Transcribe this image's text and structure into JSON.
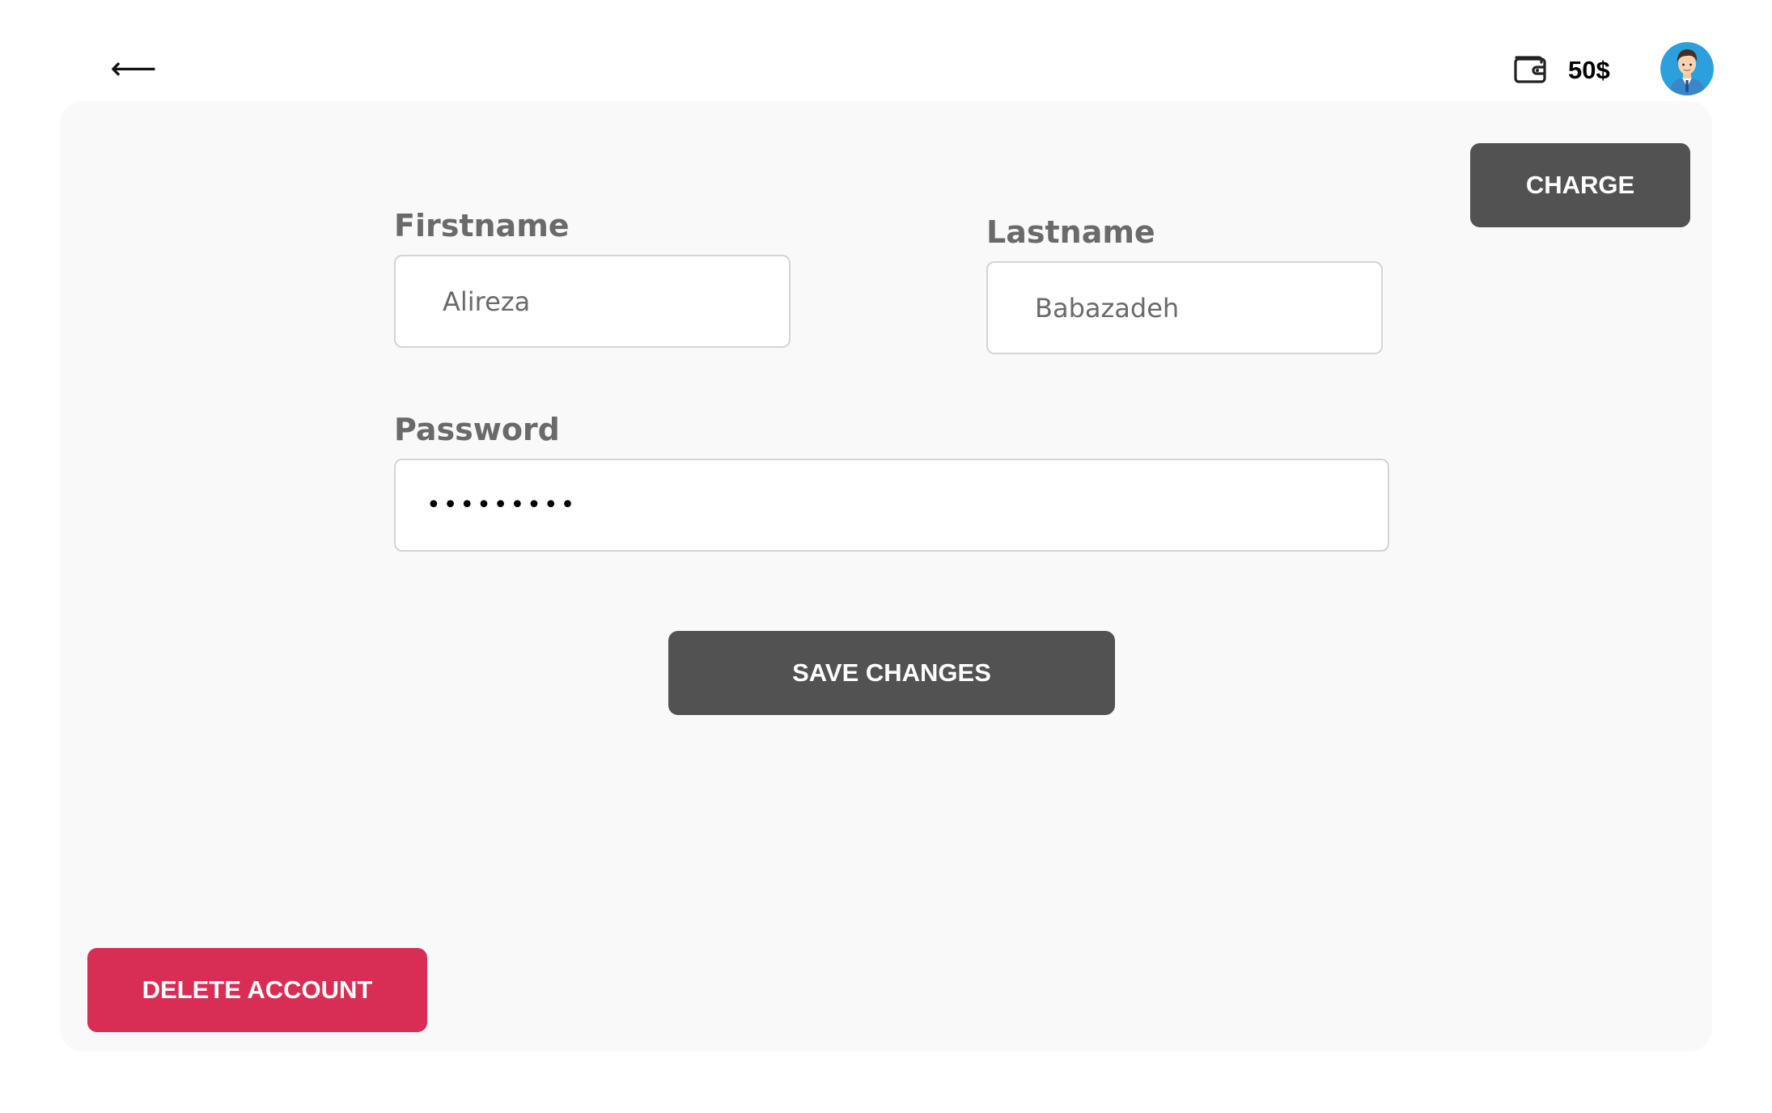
{
  "header": {
    "back_icon": "left-arrow-icon",
    "back_glyph": "⟵",
    "wallet_icon": "wallet-icon",
    "balance": "50$",
    "avatar_icon": "user-avatar"
  },
  "form": {
    "firstname": {
      "label": "Firstname",
      "value": "Alireza"
    },
    "lastname": {
      "label": "Lastname",
      "value": "Babazadeh"
    },
    "password": {
      "label": "Password",
      "value": "•••••••••"
    }
  },
  "buttons": {
    "charge": "CHARGE",
    "save": "SAVE CHANGES",
    "delete": "DELETE ACCOUNT"
  },
  "colors": {
    "card_background": "#f9f9f9",
    "dark_button": "#525252",
    "danger_button": "#d82d55",
    "label_text": "#6a6a6a",
    "input_border": "#d4d4d4"
  }
}
